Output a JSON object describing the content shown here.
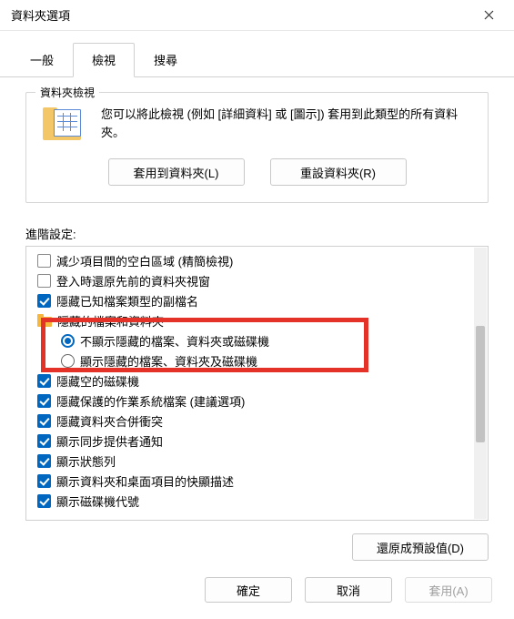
{
  "window": {
    "title": "資料夾選項"
  },
  "tabs": {
    "general": "一般",
    "view": "檢視",
    "search": "搜尋"
  },
  "folderView": {
    "groupLabel": "資料夾檢視",
    "description": "您可以將此檢視 (例如 [詳細資料] 或 [圖示]) 套用到此類型的所有資料夾。",
    "applyBtn": "套用到資料夾(L)",
    "resetBtn": "重設資料夾(R)"
  },
  "advanced": {
    "label": "進階設定:",
    "items": [
      {
        "kind": "check",
        "checked": false,
        "text": "減少項目間的空白區域 (精簡檢視)"
      },
      {
        "kind": "check",
        "checked": false,
        "text": "登入時還原先前的資料夾視窗"
      },
      {
        "kind": "check",
        "checked": true,
        "text": "隱藏已知檔案類型的副檔名"
      },
      {
        "kind": "folder",
        "text": "隱藏的檔案和資料夾"
      },
      {
        "kind": "radio",
        "checked": true,
        "indent": 1,
        "text": "不顯示隱藏的檔案、資料夾或磁碟機"
      },
      {
        "kind": "radio",
        "checked": false,
        "indent": 1,
        "text": "顯示隱藏的檔案、資料夾及磁碟機"
      },
      {
        "kind": "check",
        "checked": true,
        "text": "隱藏空的磁碟機"
      },
      {
        "kind": "check",
        "checked": true,
        "text": "隱藏保護的作業系統檔案 (建議選項)"
      },
      {
        "kind": "check",
        "checked": true,
        "text": "隱藏資料夾合併衝突"
      },
      {
        "kind": "check",
        "checked": true,
        "text": "顯示同步提供者通知"
      },
      {
        "kind": "check",
        "checked": true,
        "text": "顯示狀態列"
      },
      {
        "kind": "check",
        "checked": true,
        "text": "顯示資料夾和桌面項目的快顯描述"
      },
      {
        "kind": "check",
        "checked": true,
        "text": "顯示磁碟機代號"
      }
    ],
    "restoreBtn": "還原成預設值(D)"
  },
  "footer": {
    "ok": "確定",
    "cancel": "取消",
    "apply": "套用(A)"
  }
}
